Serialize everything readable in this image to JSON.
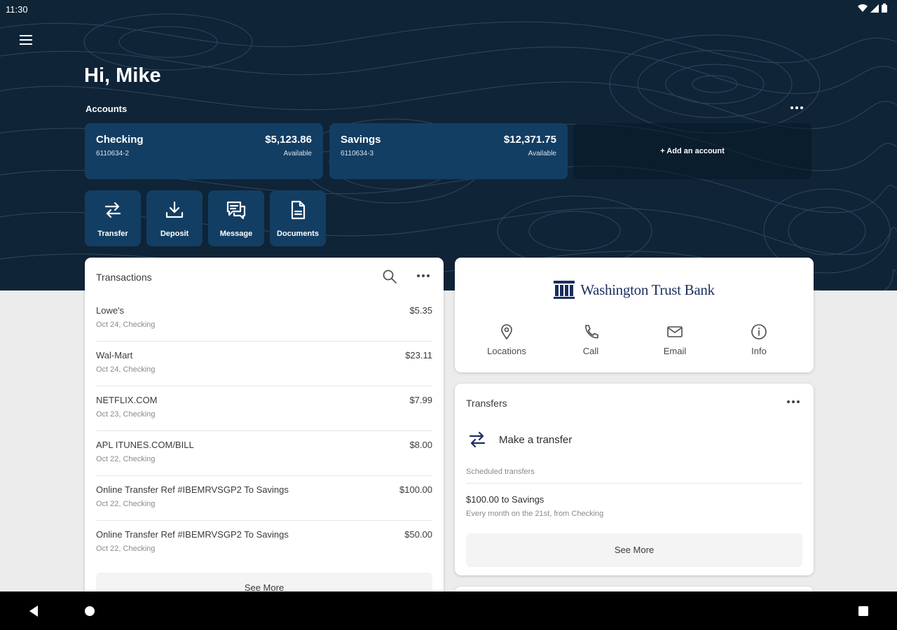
{
  "status_bar": {
    "time": "11:30"
  },
  "greeting": "Hi, Mike",
  "accounts": {
    "label": "Accounts",
    "items": [
      {
        "name": "Checking",
        "number": "6110634-2",
        "balance": "$5,123.86",
        "balance_label": "Available"
      },
      {
        "name": "Savings",
        "number": "6110634-3",
        "balance": "$12,371.75",
        "balance_label": "Available"
      }
    ],
    "add_label": "+ Add an account"
  },
  "quick_actions": [
    {
      "label": "Transfer",
      "icon": "transfer-icon"
    },
    {
      "label": "Deposit",
      "icon": "download-icon"
    },
    {
      "label": "Message",
      "icon": "message-icon"
    },
    {
      "label": "Documents",
      "icon": "document-icon"
    }
  ],
  "transactions": {
    "title": "Transactions",
    "items": [
      {
        "desc": "Lowe's",
        "meta": "Oct 24, Checking",
        "amount": "$5.35"
      },
      {
        "desc": "Wal-Mart",
        "meta": "Oct 24, Checking",
        "amount": "$23.11"
      },
      {
        "desc": "NETFLIX.COM",
        "meta": "Oct 23, Checking",
        "amount": "$7.99"
      },
      {
        "desc": "APL ITUNES.COM/BILL",
        "meta": "Oct 22, Checking",
        "amount": "$8.00"
      },
      {
        "desc": "Online Transfer Ref #IBEMRVSGP2 To Savings",
        "meta": "Oct 22, Checking",
        "amount": "$100.00"
      },
      {
        "desc": "Online Transfer Ref #IBEMRVSGP2 To Savings",
        "meta": "Oct 22, Checking",
        "amount": "$50.00"
      }
    ],
    "see_more": "See More"
  },
  "bank": {
    "name": "Washington Trust Bank",
    "contacts": [
      {
        "label": "Locations",
        "icon": "location-pin-icon"
      },
      {
        "label": "Call",
        "icon": "phone-icon"
      },
      {
        "label": "Email",
        "icon": "mail-icon"
      },
      {
        "label": "Info",
        "icon": "info-icon"
      }
    ]
  },
  "transfers": {
    "title": "Transfers",
    "make_transfer": "Make a transfer",
    "scheduled_label": "Scheduled transfers",
    "scheduled": [
      {
        "title": "$100.00 to Savings",
        "detail": "Every month on the 21st, from Checking"
      }
    ],
    "see_more": "See More"
  },
  "colors": {
    "hero_bg": "#0f2437",
    "tile": "#133e63",
    "brand_navy": "#1b2f5e",
    "page_bg": "#ececec"
  }
}
